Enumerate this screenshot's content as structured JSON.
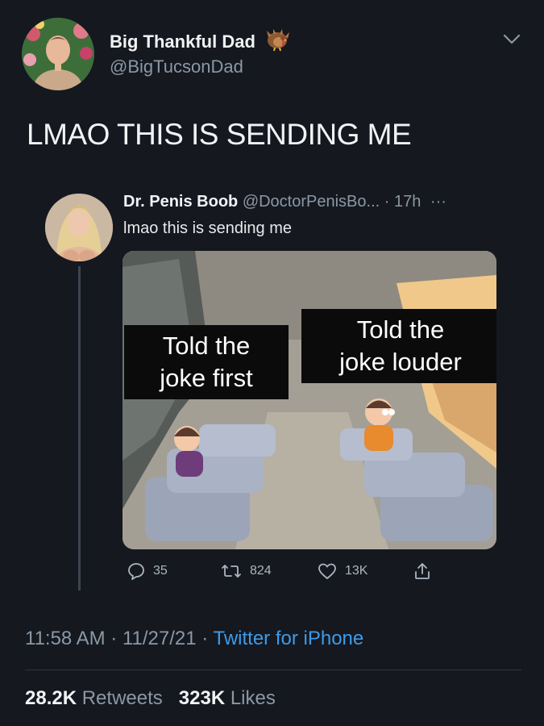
{
  "tweet": {
    "author": {
      "display_name": "Big Thankful Dad",
      "handle": "@BigTucsonDad",
      "emoji_icon": "turkey-icon"
    },
    "text": "LMAO THIS IS SENDING ME",
    "timestamp": "11:58 AM · 11/27/21 · ",
    "source": "Twitter for iPhone",
    "retweets_count": "28.2K",
    "retweets_label": "Retweets",
    "likes_count": "323K",
    "likes_label": "Likes"
  },
  "quoted": {
    "display_name": "Dr. Penis Boob",
    "handle": "@DoctorPenisBo...",
    "age": "· 17h",
    "more": "···",
    "text": "lmao this is sending me",
    "meme": {
      "left_caption": "Told the\njoke first",
      "right_caption": "Told the\njoke louder"
    },
    "actions": {
      "replies": "35",
      "retweets": "824",
      "likes": "13K"
    }
  },
  "colors": {
    "background": "#15181f",
    "link": "#3d9be9",
    "secondary_text": "#8b98a5"
  }
}
